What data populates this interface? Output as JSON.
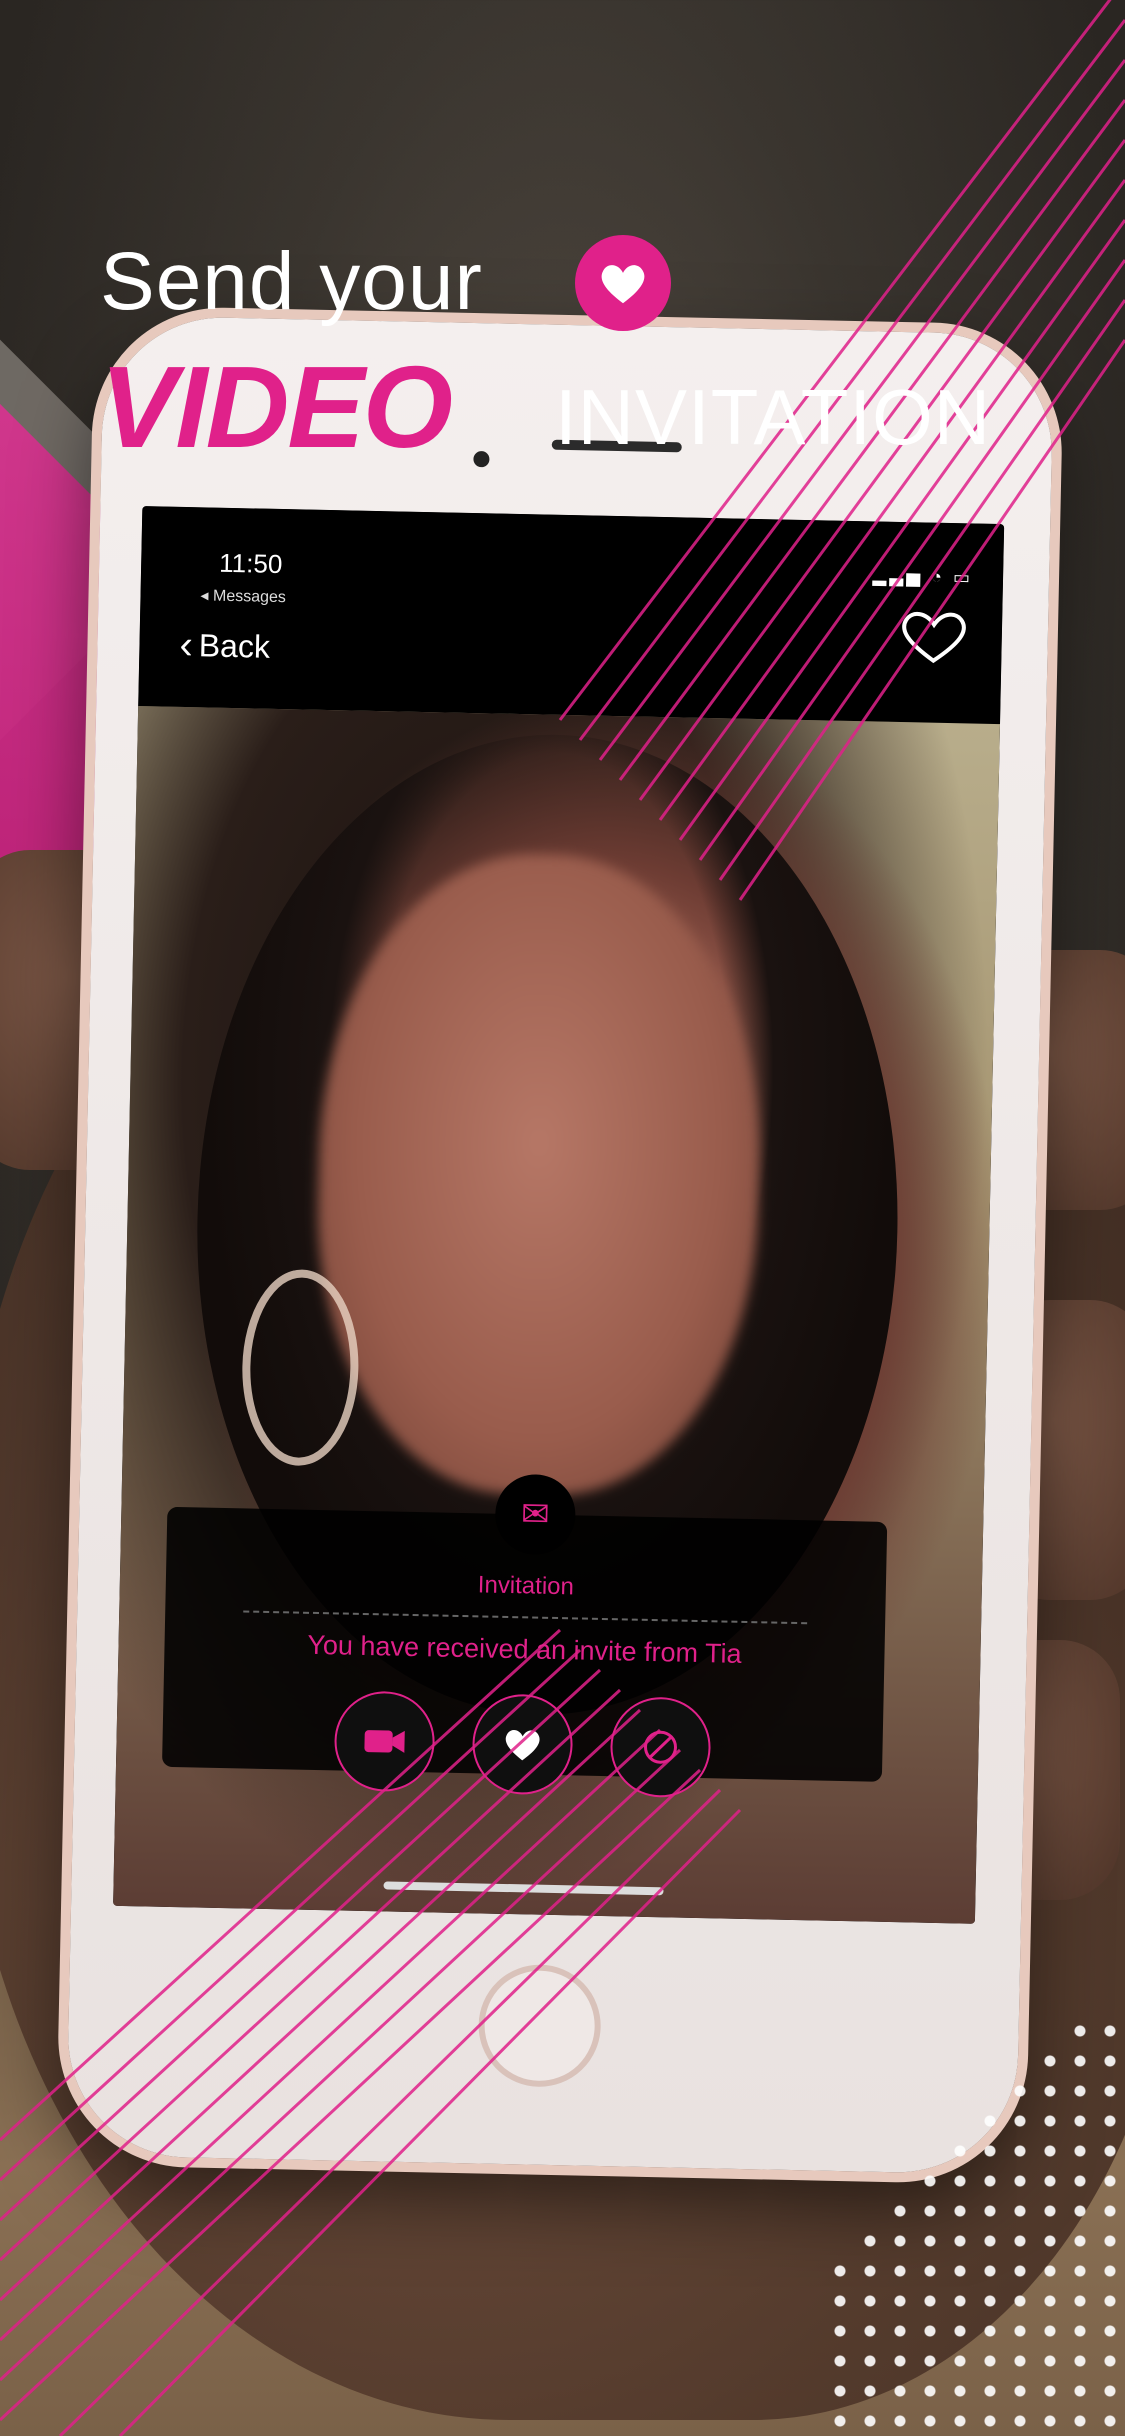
{
  "headline": {
    "line1": "Send your",
    "emphasis": "VIDEO",
    "rest": "INVITATION"
  },
  "phone": {
    "status": {
      "time": "11:50",
      "back_app": "◂ Messages"
    },
    "nav": {
      "back_label": "Back"
    },
    "invite": {
      "title": "Invitation",
      "message": "You have received an invite from Tia"
    }
  },
  "colors": {
    "accent": "#e0218a"
  }
}
